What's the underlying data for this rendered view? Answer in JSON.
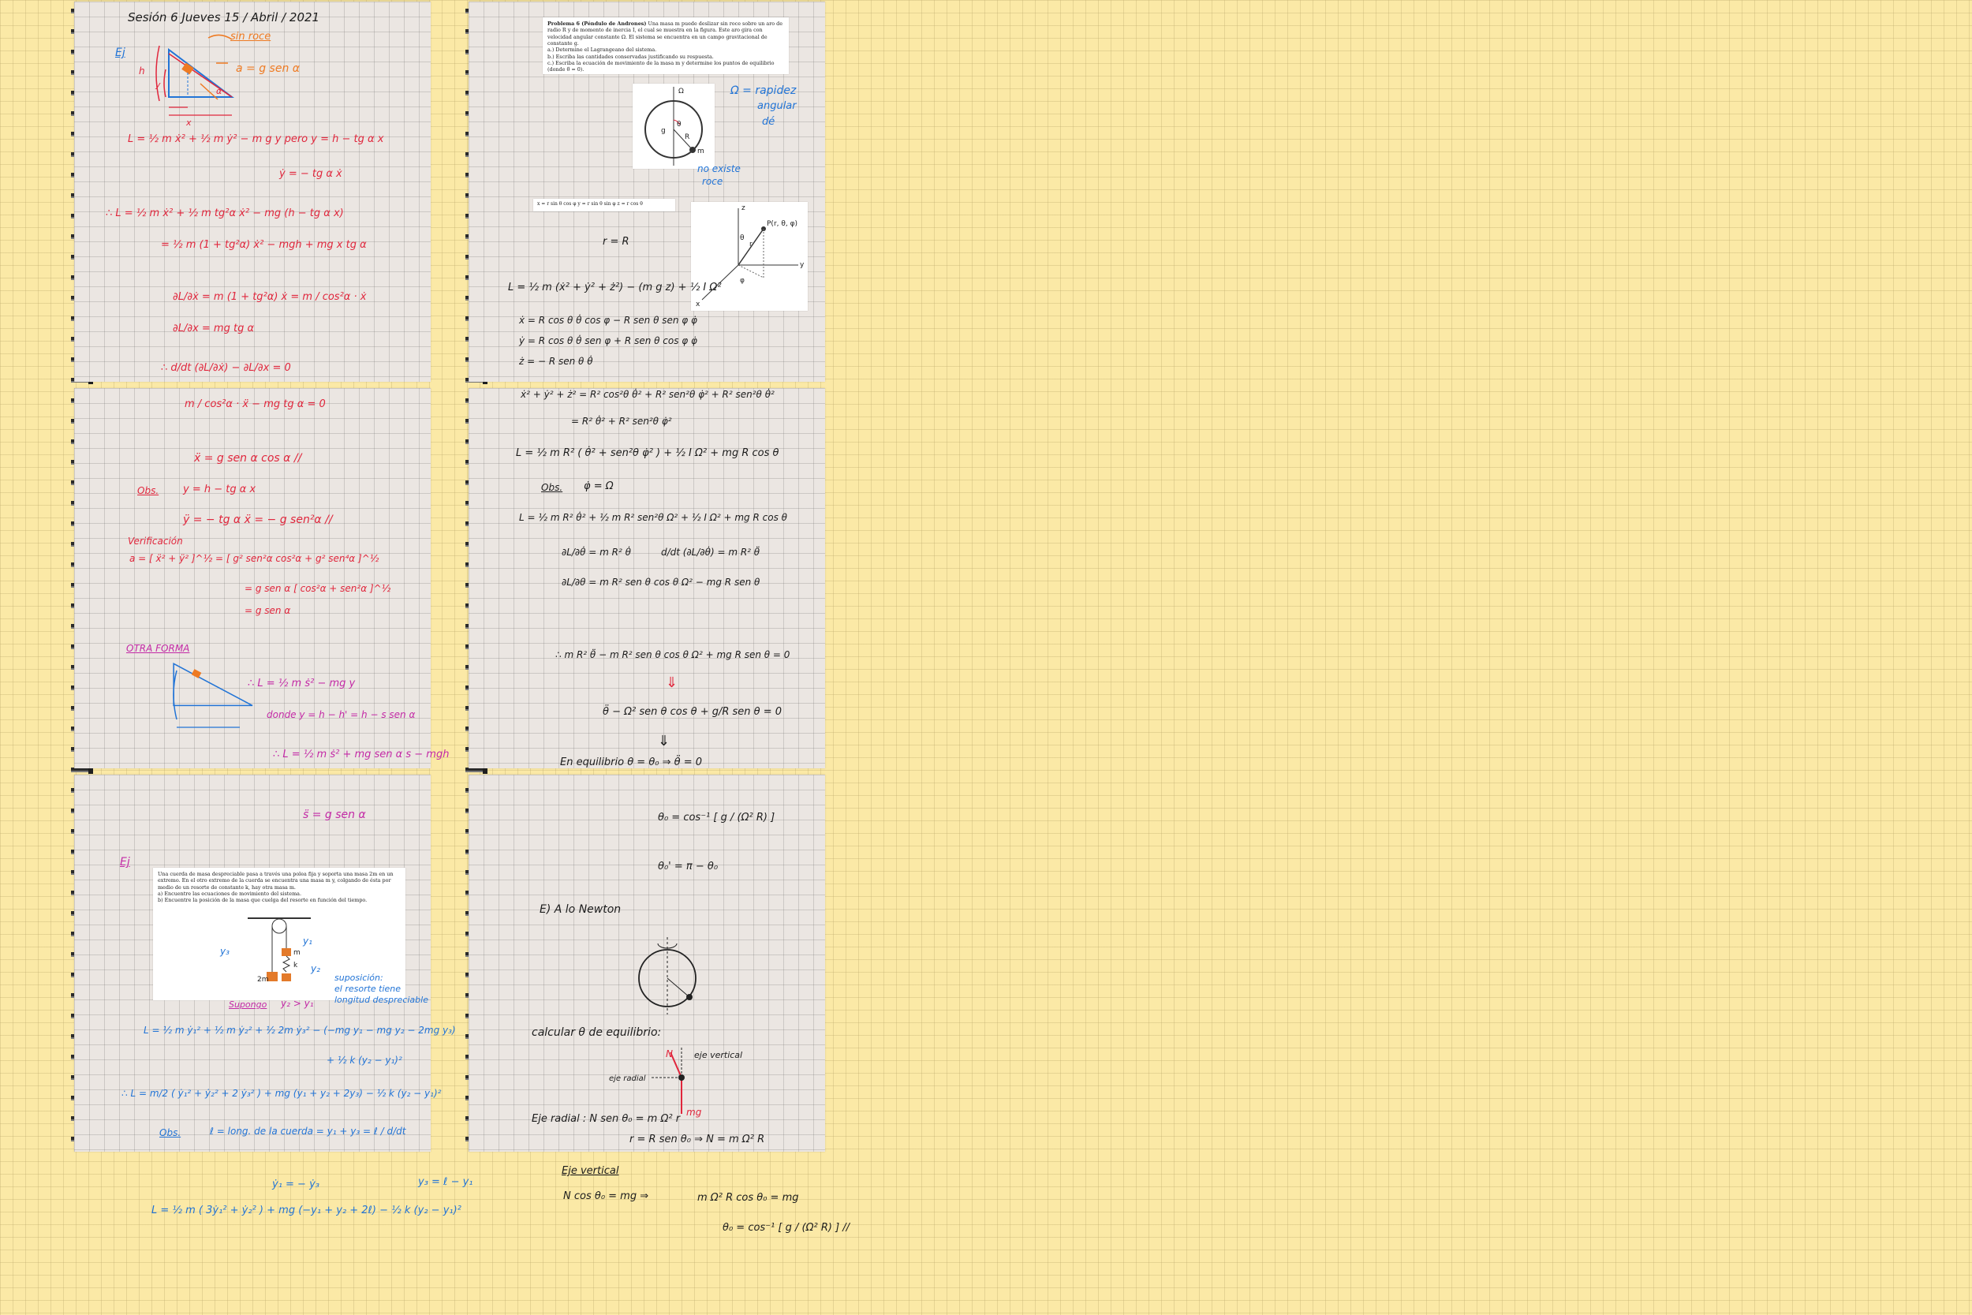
{
  "pages": {
    "left_header": "Sesión 6   Jueves   15 / Abril / 2021",
    "ej_label": "Ej",
    "ej2_label": "Ej"
  },
  "left": {
    "incline_note": "sin roce",
    "accel": "a = g sen α",
    "h_label": "h",
    "y_label": "y",
    "x_label": "x",
    "alpha": "α",
    "L1": "L = ½ m ẋ² + ½ m ẏ² − m g y      pero   y = h − tg α x",
    "ydot": "ẏ = − tg α ẋ",
    "L2": "∴  L = ½ m ẋ² + ½ m tg²α ẋ² − mg (h − tg α x)",
    "L3": "= ½ m (1 + tg²α) ẋ² − mgh + mg x tg α",
    "dLdxdot": "∂L/∂ẋ = m (1 + tg²α) ẋ  =  m / cos²α · ẋ",
    "dLdx": "∂L/∂x = mg tg α",
    "EL": "∴  d/dt (∂L/∂ẋ) − ∂L/∂x = 0",
    "eq1": "m / cos²α · ẍ − mg tg α = 0",
    "xddot": "ẍ = g sen α cos α //",
    "obs": "Obs.",
    "yrel": "y = h − tg α x",
    "yddot": "ÿ = − tg α ẍ = − g sen²α //",
    "verif": "Verificación",
    "a_mag": "a = [ ẍ² + ÿ² ]^½  =  [ g² sen²α cos²α + g² sen⁴α ]^½",
    "a_mag2": "= g sen α [ cos²α + sen²α ]^½",
    "a_mag3": "= g sen α",
    "otra": "OTRA FORMA",
    "L_s": "∴  L = ½ m ṡ² − mg y",
    "donde": "donde   y = h − h' = h − s sen α",
    "L_s2": "∴  L = ½ m ṡ² + mg sen α s − mgh",
    "sddot": "s̈ = g sen α",
    "supongo": "Supongo",
    "y2y1": "y₂ > y₁",
    "suposicion": "suposición:",
    "resorte1": "el resorte tiene",
    "resorte2": "longitud despreciable",
    "L_atw1": "L = ½ m ẏ₁² + ½ m ẏ₂² + ½ 2m ẏ₃² − (−mg y₁ − mg y₂ − 2mg y₃)",
    "L_atw2": "+ ½ k (y₂ − y₁)²",
    "L_atw3": "∴  L = m/2 ( ẏ₁² + ẏ₂² + 2 ẏ₃² ) + mg (y₁ + y₂ + 2y₃) − ½ k (y₂ − y₁)²",
    "obs2": "Obs.",
    "cuerda": "ℓ = long. de la cuerda = y₁ + y₃ = ℓ / d/dt",
    "y1dot": "ẏ₁ = − ẏ₃",
    "y3": "y₃ = ℓ − y₁",
    "L_final": "L = ½ m ( 3ẏ₁² + ẏ₂² ) + mg (−y₁ + y₂ + 2ℓ) − ½ k (y₂ − y₁)²"
  },
  "problem_card": {
    "title": "Problema 6 (Péndulo de Andrones)",
    "body": "Una masa m puede deslizar sin roce sobre un aro de radio R y de momento de inercia I, el cual se muestra en la figura. Este aro gira con velocidad angular constante Ω. El sistema se encuentra en un campo gravitacional de constante g.",
    "items": [
      "a.) Determine el Lagrangeano del sistema.",
      "b.) Escriba las cantidades conservadas justificando su respuesta.",
      "c.) Escriba la ecuación de movimiento de la masa m y determine los puntos de equilibrio (donde θ̈ = 0)."
    ],
    "fig_labels": {
      "omega": "Ω",
      "g": "g",
      "R": "R",
      "m": "m",
      "theta": "θ"
    }
  },
  "atwood_card": {
    "body": "Una cuerda de masa despreciable pasa a través una polea fija y soporta una masa 2m en un extremo. En el otro extremo de la cuerda se encuentra una masa m y, colgando de ésta por medio de un resorte de constante k, hay otra masa m.",
    "items": [
      "a) Encuentre las ecuaciones de movimiento del sistema.",
      "b) Encuentre la posición de la masa que cuelga del resorte en función del tiempo."
    ],
    "fig_labels": {
      "y3": "y₃",
      "y1": "y₁",
      "y2": "y₂",
      "m": "m",
      "k": "k",
      "twom": "2m"
    }
  },
  "spherical_card": {
    "coords": "x = r sin θ cos φ     y = r sin θ sin φ     z = r cos θ",
    "point": "P(r, θ, φ)",
    "axes": {
      "x": "x",
      "y": "y",
      "z": "z",
      "r": "r",
      "theta": "θ",
      "phi": "φ"
    }
  },
  "right": {
    "omega_note1": "Ω = rapidez",
    "omega_note2": "angular",
    "omega_note3": "dé",
    "noroce1": "no existe",
    "noroce2": "roce",
    "r_eq_R": "r = R",
    "L_sph": "L = ½ m (ẋ² + ẏ² + ż²) − (m g z) + ½ I Ω²",
    "xdot": "ẋ = R cos θ θ̇ cos φ − R sen θ sen φ φ̇",
    "ydot": "ẏ = R cos θ θ̇ sen φ + R sen θ cos φ φ̇",
    "zdot": "ż = − R sen θ θ̇",
    "sumsq": "ẋ² + ẏ² + ż² = R² cos²θ θ̇² + R² sen²θ φ̇² + R² sen²θ θ̇²",
    "sumsq2": "= R² θ̇² + R² sen²θ φ̇²",
    "L_R": "L = ½ m R² ( θ̇² + sen²θ φ̇² ) + ½ I Ω² + mg R cos θ",
    "obs": "Obs.",
    "phidot": "φ̇ = Ω",
    "L_R2": "L = ½ m R² θ̇² + ½ m R² sen²θ Ω² + ½ I Ω² + mg R cos θ",
    "dLdthdot": "∂L/∂θ̇ = m R² θ̇",
    "ddt": "d/dt (∂L/∂θ̇) = m R² θ̈",
    "dLdth": "∂L/∂θ = m R² sen θ cos θ Ω² − mg R sen θ",
    "EOM": "∴   m R² θ̈ − m R² sen θ cos θ Ω² + mg R sen θ = 0",
    "EOM2": "θ̈ − Ω² sen θ cos θ + g/R sen θ = 0",
    "equil": "En equilibrio  θ = θ₀    ⇒   θ̈ = 0",
    "theta0": "θ₀ = cos⁻¹ [ g / (Ω² R) ]",
    "theta0p": "θ₀' = π − θ₀",
    "newton": "E)  A lo Newton",
    "calc": "calcular θ de equilibrio:",
    "ejevert": "eje vertical",
    "ejerad": "eje radial",
    "N_label": "N",
    "mg_label": "mg",
    "rad_eq": "Eje radial :  N sen θ₀ = m Ω² r",
    "r_eq": "r = R sen θ₀    ⇒   N = m Ω² R",
    "vert_title": "Eje vertical",
    "vert_eq": "N cos θ₀ = mg    ⇒",
    "vert_res": "m Ω² R cos θ₀ = mg",
    "final": "θ₀ = cos⁻¹ [ g / (Ω² R) ] //"
  }
}
